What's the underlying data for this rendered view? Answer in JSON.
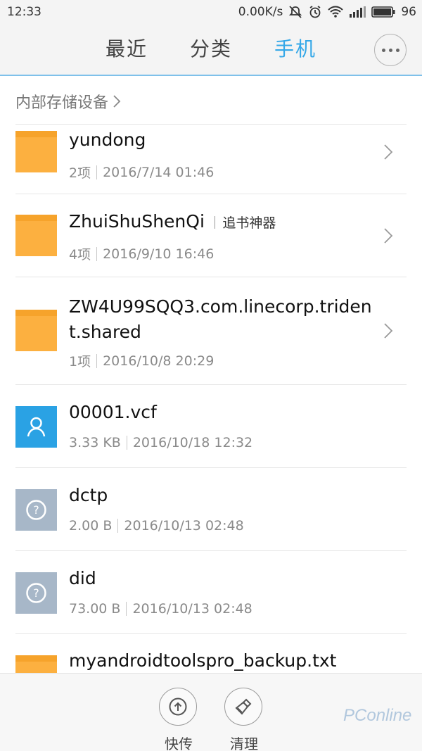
{
  "status_bar": {
    "time": "12:33",
    "network_speed": "0.00K/s",
    "battery_level": "96",
    "icons": [
      "mute-icon",
      "alarm-icon",
      "wifi-icon",
      "signal-icon",
      "battery-icon"
    ]
  },
  "tabs": [
    {
      "label": "最近",
      "active": false
    },
    {
      "label": "分类",
      "active": false
    },
    {
      "label": "手机",
      "active": true
    }
  ],
  "accent_color": "#35a8e8",
  "breadcrumb": {
    "label": "内部存储设备"
  },
  "files": [
    {
      "type": "folder",
      "name": "yundong",
      "alias": "",
      "count": "2项",
      "date": "2016/7/14 01:46"
    },
    {
      "type": "folder",
      "name": "ZhuiShuShenQi",
      "alias": "追书神器",
      "count": "4项",
      "date": "2016/9/10 16:46"
    },
    {
      "type": "folder",
      "name_line1": "ZW4U99SQQ3.com.linecorp.triden",
      "name_line2": "t.shared",
      "count": "1项",
      "date": "2016/10/8 20:29"
    },
    {
      "type": "contact",
      "name": "00001.vcf",
      "size": "3.33 KB",
      "date": "2016/10/18 12:32"
    },
    {
      "type": "unknown",
      "name": "dctp",
      "size": "2.00 B",
      "date": "2016/10/13 02:48"
    },
    {
      "type": "unknown",
      "name": "did",
      "size": "73.00 B",
      "date": "2016/10/13 02:48"
    },
    {
      "type": "folder",
      "name": "myandroidtoolspro_backup.txt"
    }
  ],
  "bottom_actions": [
    {
      "label": "快传",
      "icon": "upload-icon"
    },
    {
      "label": "清理",
      "icon": "broom-icon"
    }
  ],
  "watermark": "PConline"
}
